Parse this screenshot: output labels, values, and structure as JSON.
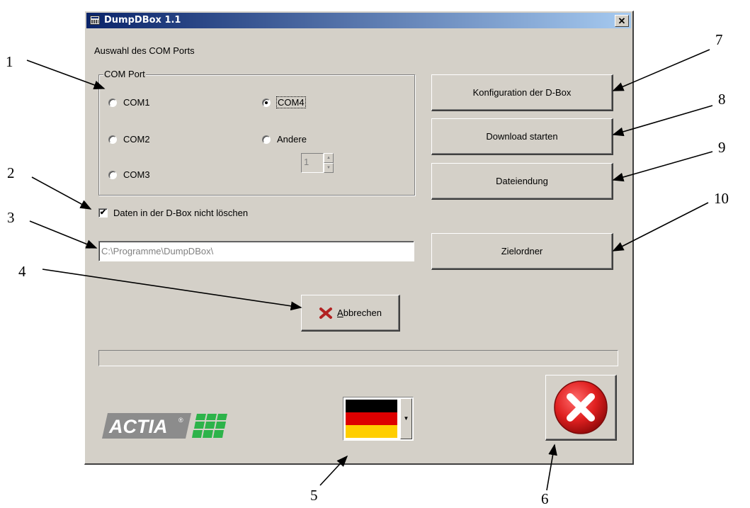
{
  "window": {
    "title": "DumpDBox 1.1",
    "close_glyph": "✕"
  },
  "section_label": "Auswahl des COM Ports",
  "com_group": {
    "legend": "COM Port",
    "options": [
      {
        "label": "COM1",
        "checked": false
      },
      {
        "label": "COM2",
        "checked": false
      },
      {
        "label": "COM3",
        "checked": false
      },
      {
        "label": "COM4",
        "checked": true
      },
      {
        "label": "Andere",
        "checked": false
      }
    ],
    "other_value": "1"
  },
  "keep_data_checkbox": {
    "label": "Daten in der D-Box nicht löschen",
    "checked": true,
    "check_glyph": "✔"
  },
  "target_path": "C:\\Programme\\DumpDBox\\",
  "buttons": {
    "config": "Konfiguration der D-Box",
    "download": "Download starten",
    "extension": "Dateiendung",
    "target_folder": "Zielordner",
    "cancel_mnemonic": "A",
    "cancel_rest": "bbrechen"
  },
  "progress_fraction": 0,
  "logo_text": "ACTIA",
  "logo_mark": "®",
  "language_flag": {
    "colors": [
      "#000000",
      "#dd0000",
      "#ffce00"
    ]
  },
  "colors": {
    "cancel_icon": "#b22222",
    "exit_icon": "#e02020",
    "logo_green": "#2db34a",
    "logo_gray": "#8c8c8c"
  },
  "callouts": [
    "1",
    "2",
    "3",
    "4",
    "5",
    "6",
    "7",
    "8",
    "9",
    "10"
  ]
}
